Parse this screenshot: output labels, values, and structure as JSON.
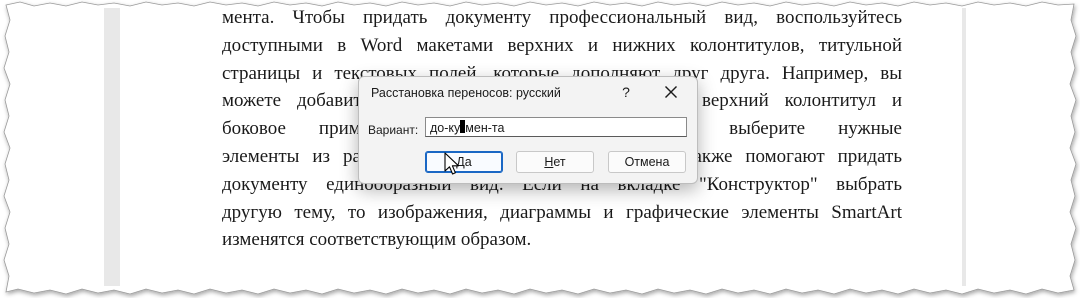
{
  "document": {
    "lines": [
      "мента. Чтобы придать документу профессиональный вид, воспользуйтесь",
      "доступными в Word макетами верхних и нижних колонтитулов, титульной",
      "страницы и текстовых полей, которые дополняют друг друга. Например, вы",
      "можете добавить подходящую титульную страницу, верхний колонтитул и",
      "боковое примечание. Щелкните «Вставка» и выберите нужные",
      "элементы из различных коллекций. Темы и стили также помогают придать",
      "документу единообразный вид. Если на вкладке \"Конструктор\" выбрать",
      "другую тему, то изображения, диаграммы и графические элементы SmartArt",
      "изменятся соответствующим образом."
    ]
  },
  "dialog": {
    "title": "Расстановка переносов: русский",
    "help": "?",
    "variant_label": "Вариант:",
    "variant_before": "до-ку",
    "variant_after": "мен-та",
    "buttons": {
      "yes_underlined": "Д",
      "yes_rest": "а",
      "no_underlined": "Н",
      "no_rest": "ет",
      "cancel": "Отмена"
    }
  },
  "colors": {
    "accent": "#1a67c4",
    "dialog_bg": "#f3f3f3",
    "margin_gray": "#e8e8e8"
  },
  "icons": [
    "close-icon",
    "mouse-pointer-icon"
  ]
}
